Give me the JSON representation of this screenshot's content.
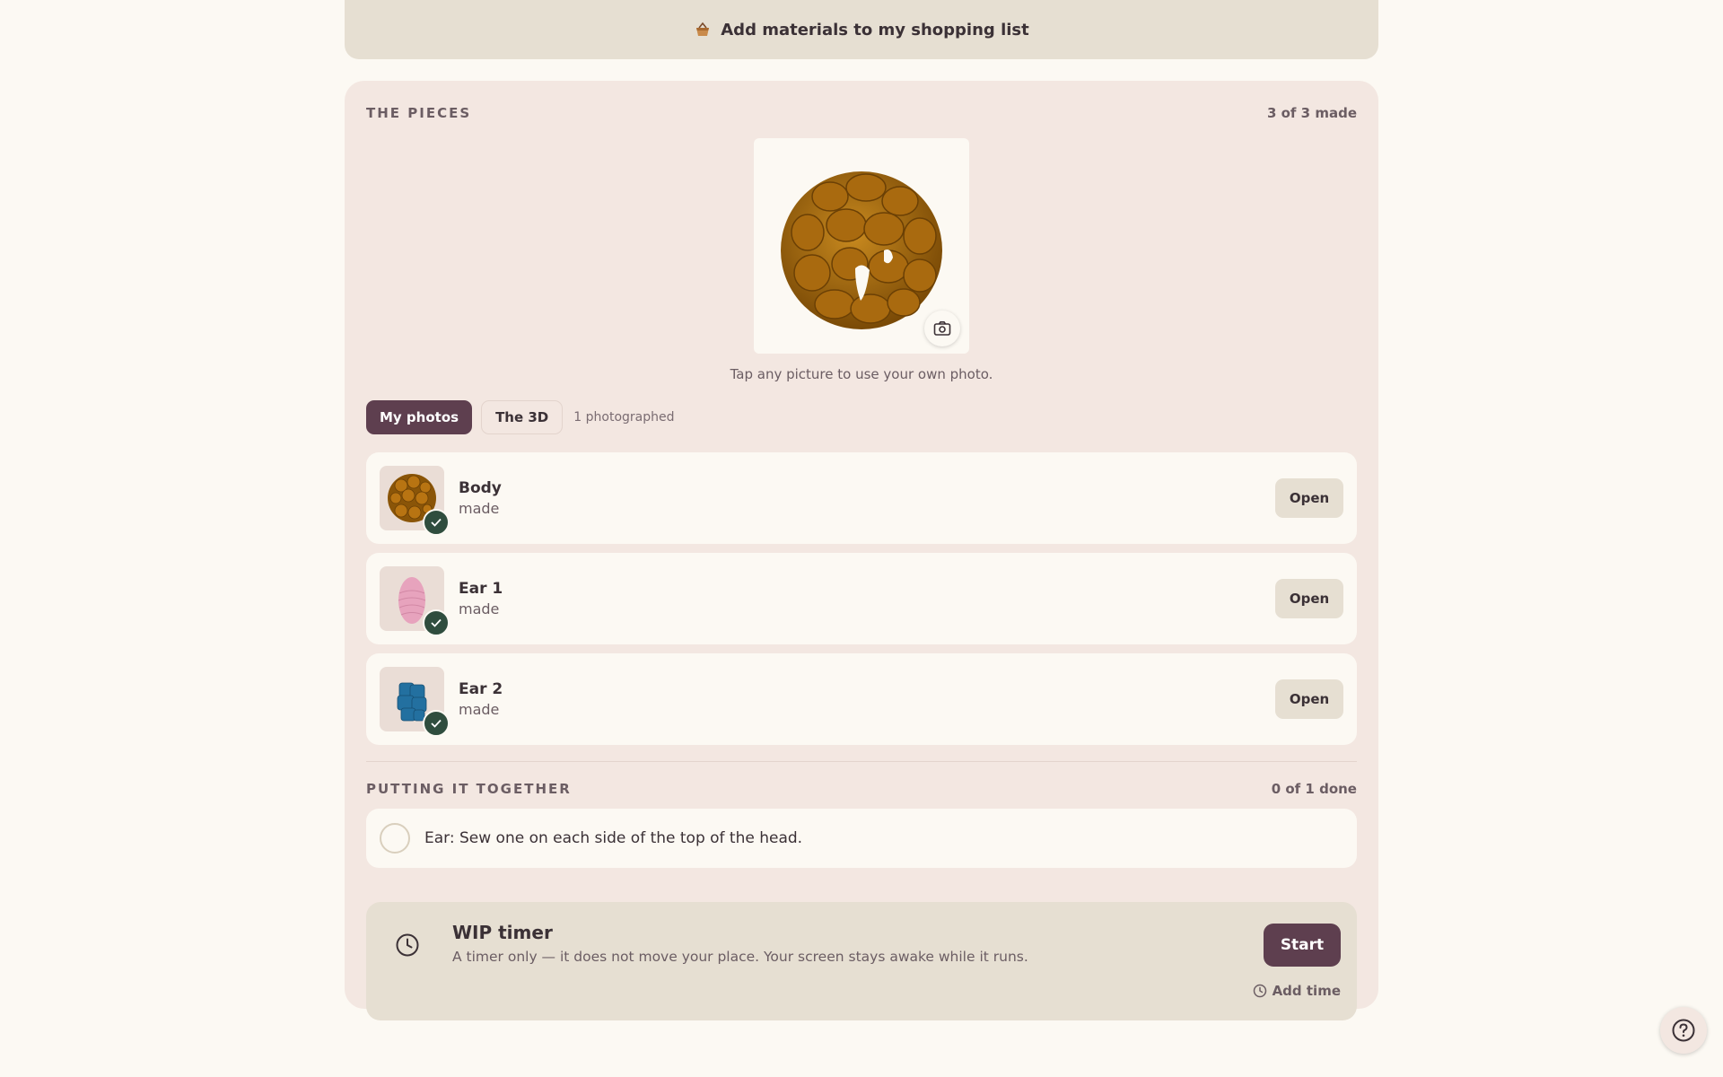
{
  "shopping": {
    "label": "Add materials to my shopping list",
    "icon": "basket-icon"
  },
  "pieces_section": {
    "title": "THE PIECES",
    "count": "3 of 3 made",
    "hero_caption": "Tap any picture to use your own photo.",
    "tabs": [
      {
        "label": "My photos",
        "active": true
      },
      {
        "label": "The 3D",
        "active": false
      }
    ],
    "photographed_note": "1 photographed",
    "items": [
      {
        "name": "Body",
        "status": "made",
        "action": "Open",
        "color": "#a96a0f"
      },
      {
        "name": "Ear 1",
        "status": "made",
        "action": "Open",
        "color": "#e7a3bd"
      },
      {
        "name": "Ear 2",
        "status": "made",
        "action": "Open",
        "color": "#2370a0"
      }
    ]
  },
  "assembly": {
    "title": "PUTTING IT TOGETHER",
    "count": "0 of 1 done",
    "steps": [
      {
        "text": "Ear: Sew one on each side of the top of the head.",
        "done": false
      }
    ]
  },
  "timer": {
    "title": "WIP timer",
    "description": "A timer only — it does not move your place. Your screen stays awake while it runs.",
    "start_label": "Start",
    "add_time_label": "Add time"
  },
  "colors": {
    "accent": "#5e3f4f",
    "check": "#2f4d3e",
    "background": "#fcf9f3",
    "card": "#f3e7e1"
  }
}
